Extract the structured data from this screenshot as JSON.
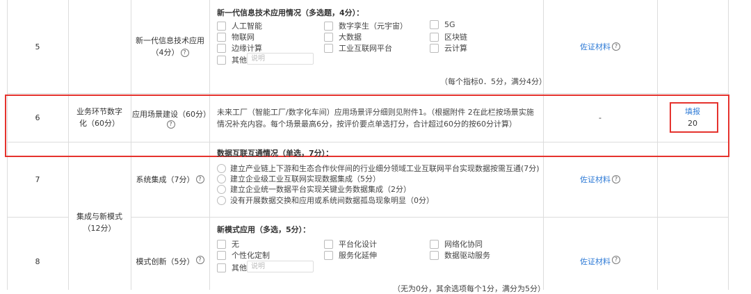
{
  "rows": [
    {
      "num": "5",
      "indicator": "新一代信息技术应用",
      "indicator_score": "（4分）",
      "question": "新一代信息技术应用情况（多选题，4分）：",
      "options": [
        "人工智能",
        "数字孪生（元宇宙）",
        "5G",
        "物联网",
        "大数据",
        "区块链",
        "边缘计算",
        "工业互联网平台",
        "云计算",
        "其他"
      ],
      "other_placeholder": "说明",
      "score_note": "（每个指标0．5分，满分4分）",
      "evidence": "佐证材料"
    },
    {
      "num": "6",
      "category": "业务环节数字化（60分）",
      "indicator": "应用场景建设（60分）",
      "description": "未来工厂（智能工厂/数字化车间）应用场景评分细则见附件1。（根据附件 2在此栏按场景实施情况补充内容。每个场景最高6分，按评价要点单选打分，合计超过60分的按60分计算）",
      "evidence": "-",
      "fill_label": "填报",
      "fill_value": "20"
    },
    {
      "num": "7",
      "indicator": "系统集成（7分）",
      "question": "数据互联互通情况（单选，7分）：",
      "options": [
        "建立产业链上下游和生态合作伙伴间的行业细分领域工业互联网平台实现数据按需互通(7分)",
        "建立企业级工业互联网实现数据集成（5分）",
        "建立企业统一数据平台实现关键业务数据集成（2分）",
        "没有开展数据交换和应用或系统间数据孤岛现象明显（0分）"
      ],
      "evidence": "佐证材料"
    },
    {
      "num": "8",
      "category": "集成与新模式（12分）",
      "indicator": "模式创新（5分）",
      "question": "新模式应用（多选，5分）：",
      "options": [
        "无",
        "平台化设计",
        "网络化协同",
        "个性化定制",
        "服务化延伸",
        "数据驱动服务",
        "其他"
      ],
      "other_placeholder": "说明",
      "score_note": "（无为0分，其余选项每个1分，满分为5分）",
      "evidence": "佐证材料"
    }
  ],
  "help_icon": "question-circle-icon",
  "colors": {
    "link": "#2f7bd6",
    "highlight": "#e5322d",
    "border": "#dcdcdc"
  }
}
